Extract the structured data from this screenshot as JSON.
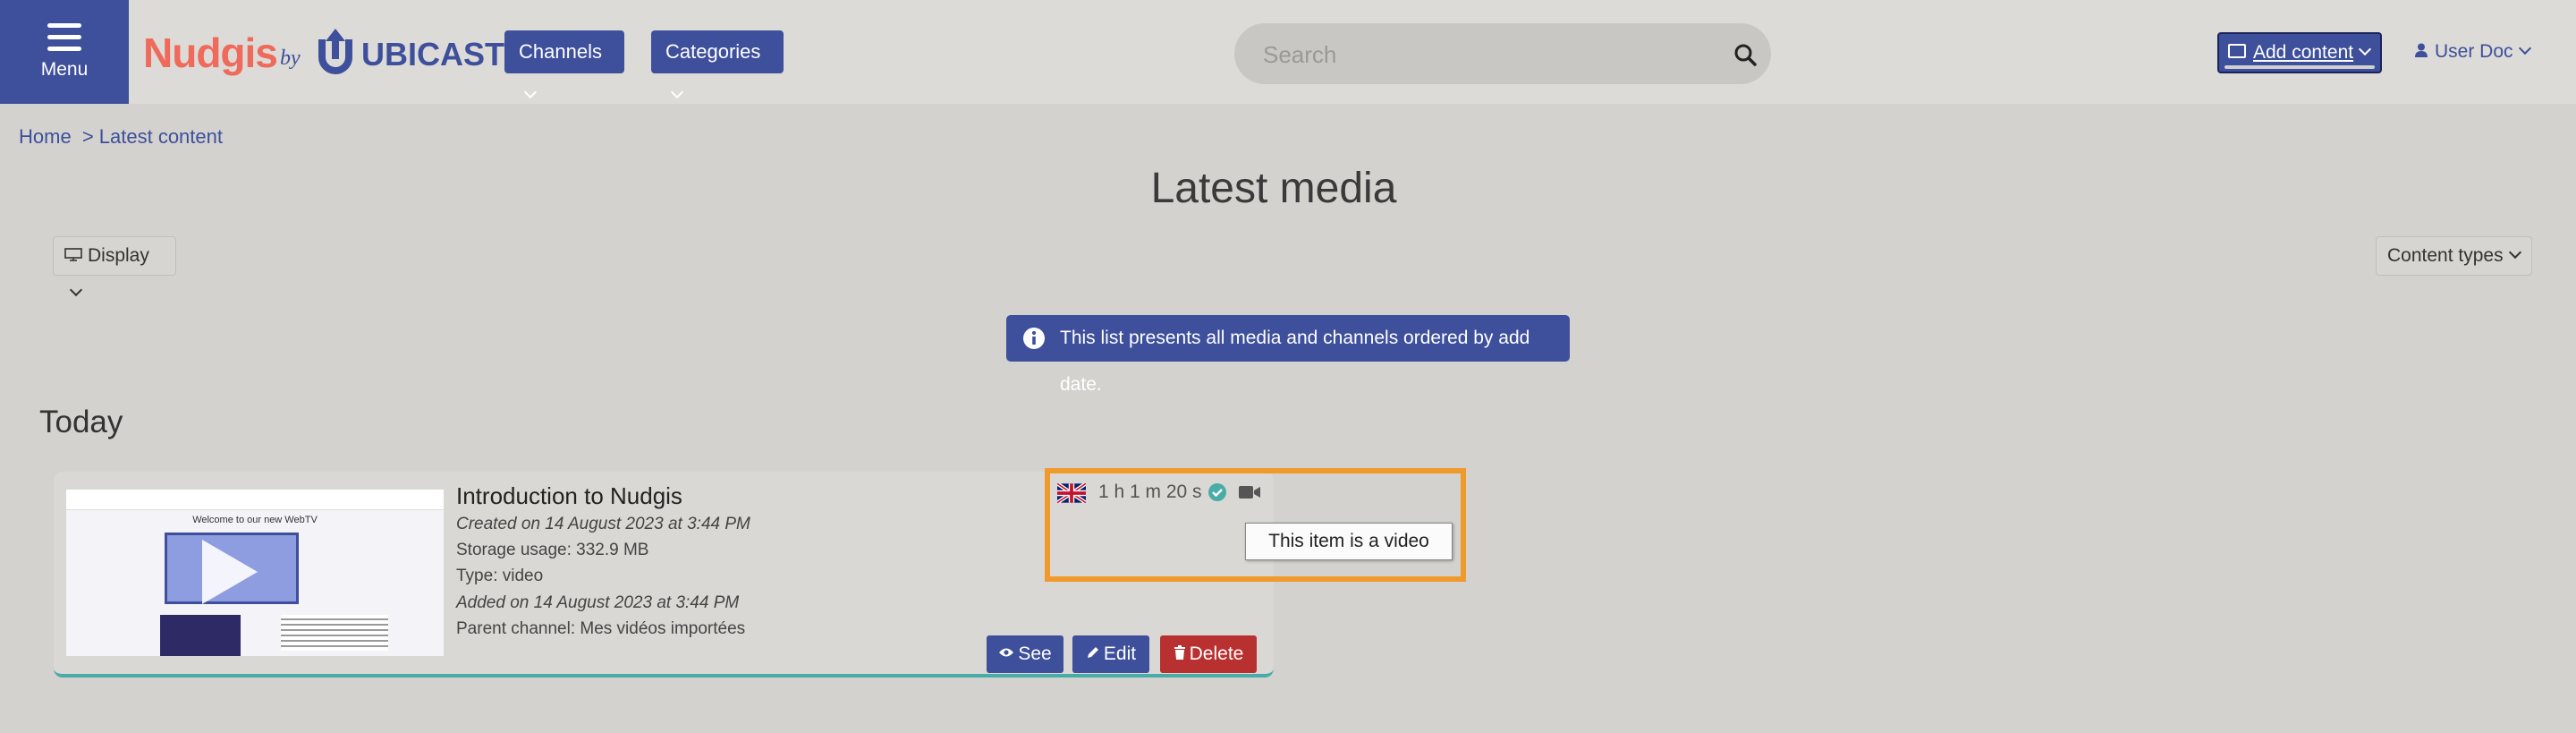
{
  "header": {
    "menu_label": "Menu",
    "logo": {
      "brand": "Nudgis",
      "by": "by",
      "partner": "UBICAST"
    },
    "channels_label": "Channels",
    "categories_label": "Categories",
    "search_placeholder": "Search",
    "add_content_label": "Add content",
    "user_label": "User Doc"
  },
  "breadcrumb": {
    "home": "Home",
    "current": "> Latest content"
  },
  "page_title": "Latest media",
  "toolbar": {
    "display_label": "Display",
    "content_types_label": "Content types"
  },
  "info_banner": "This list presents all media and channels ordered by add date.",
  "section_title": "Today",
  "media": {
    "title": "Introduction to Nudgis",
    "created": "Created on 14 August 2023 at 3:44 PM",
    "storage": "Storage usage: 332.9 MB",
    "type": "Type: video",
    "added": "Added on 14 August 2023 at 3:44 PM",
    "parent": "Parent channel: Mes vidéos importées",
    "duration": "1 h 1 m 20 s",
    "language_icon": "uk-flag-icon",
    "status_icon": "check-circle-icon",
    "type_icon": "video-camera-icon",
    "see_label": "See",
    "edit_label": "Edit",
    "delete_label": "Delete",
    "thumbnail": {
      "title": "Welcome to our new WebTV"
    }
  },
  "tooltip": "This item is a video",
  "colors": {
    "primary": "#3e4f9b",
    "danger": "#b8302f",
    "accent_teal": "#4aaca6",
    "highlight": "#f09a2b",
    "brand_coral": "#ef6a5b"
  }
}
